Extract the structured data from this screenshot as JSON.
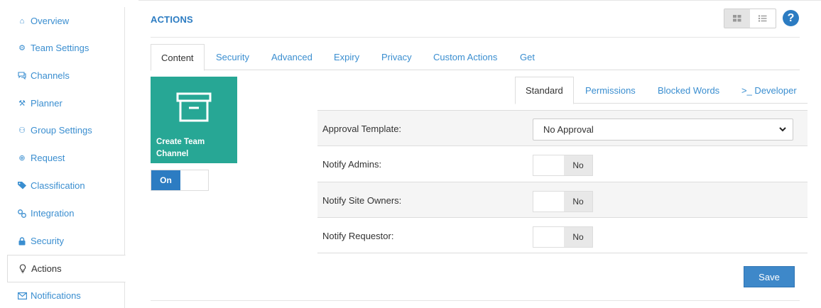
{
  "sidebar": {
    "items": [
      {
        "label": "Overview",
        "icon": "home-icon",
        "glyph": "⌂"
      },
      {
        "label": "Team Settings",
        "icon": "gears-icon",
        "glyph": "⚙"
      },
      {
        "label": "Channels",
        "icon": "chat-icon",
        "glyph": "💬"
      },
      {
        "label": "Planner",
        "icon": "planner-icon",
        "glyph": "⚒"
      },
      {
        "label": "Group Settings",
        "icon": "group-icon",
        "glyph": "⚇"
      },
      {
        "label": "Request",
        "icon": "plus-circle-icon",
        "glyph": "⊕"
      },
      {
        "label": "Classification",
        "icon": "tag-icon",
        "glyph": "⬥"
      },
      {
        "label": "Integration",
        "icon": "link-icon",
        "glyph": "∞"
      },
      {
        "label": "Security",
        "icon": "lock-icon",
        "glyph": "🔒"
      },
      {
        "label": "Actions",
        "icon": "lightbulb-icon",
        "glyph": "♀"
      },
      {
        "label": "Notifications",
        "icon": "envelope-icon",
        "glyph": "✉"
      }
    ]
  },
  "header": {
    "title": "ACTIONS",
    "help_label": "?"
  },
  "tabs": [
    {
      "label": "Content"
    },
    {
      "label": "Security"
    },
    {
      "label": "Advanced"
    },
    {
      "label": "Expiry"
    },
    {
      "label": "Privacy"
    },
    {
      "label": "Custom Actions"
    },
    {
      "label": "Get"
    }
  ],
  "tile": {
    "label": "Create Team Channel",
    "icon": "archive-box-icon",
    "toggle_label": "On"
  },
  "subtabs": [
    {
      "label": "Standard"
    },
    {
      "label": "Permissions"
    },
    {
      "label": "Blocked Words"
    },
    {
      "label": ">_ Developer"
    }
  ],
  "form": {
    "approval_template": {
      "label": "Approval Template:",
      "value": "No Approval"
    },
    "notify_admins": {
      "label": "Notify Admins:",
      "value": "No"
    },
    "notify_site_owners": {
      "label": "Notify Site Owners:",
      "value": "No"
    },
    "notify_requestor": {
      "label": "Notify Requestor:",
      "value": "No"
    }
  },
  "save_label": "Save",
  "colors": {
    "accent": "#2c7cc2",
    "link": "#3a8ed0",
    "tile": "#27a795",
    "save": "#3e88c9"
  }
}
